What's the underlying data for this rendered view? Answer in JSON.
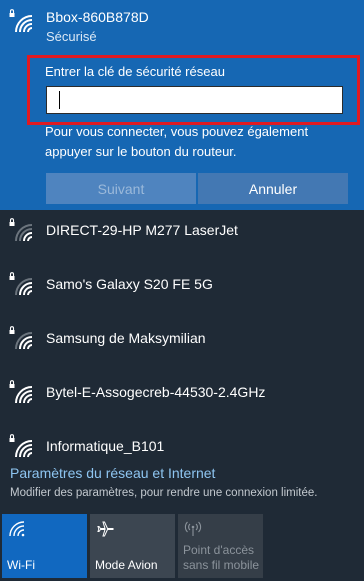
{
  "selected_network": {
    "name": "Bbox-860B878D",
    "status": "Sécurisé",
    "key_prompt": "Entrer la clé de sécurité réseau",
    "key_value": "",
    "hint": "Pour vous connecter, vous pouvez également appuyer sur le bouton du routeur.",
    "next_label": "Suivant",
    "cancel_label": "Annuler"
  },
  "networks": [
    {
      "name": "DIRECT-29-HP M277 LaserJet",
      "secured": true,
      "icon": "wifi-secured-icon"
    },
    {
      "name": "Samo's Galaxy S20 FE 5G",
      "secured": true,
      "icon": "wifi-secured-icon"
    },
    {
      "name": "Samsung de Maksymilian",
      "secured": true,
      "icon": "wifi-secured-icon"
    },
    {
      "name": "Bytel-E-Assogecreb-44530-2.4GHz",
      "secured": true,
      "icon": "wifi-secured-icon"
    },
    {
      "name": "Informatique_B101",
      "secured": true,
      "icon": "wifi-secured-icon"
    }
  ],
  "settings": {
    "link": "Paramètres du réseau et Internet",
    "description": "Modifier des paramètres, pour rendre une connexion limitée."
  },
  "tiles": {
    "wifi": "Wi-Fi",
    "airplane": "Mode Avion",
    "hotspot": "Point d'accès sans fil mobile"
  },
  "colors": {
    "accent": "#1667b3",
    "highlight_border": "#e01a22",
    "background": "#1f2a36",
    "link": "#8ec5f1"
  }
}
